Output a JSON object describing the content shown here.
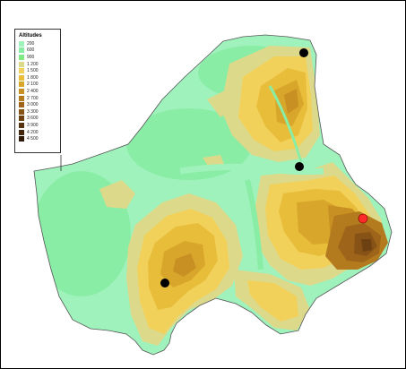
{
  "legend": {
    "title": "Altitudes",
    "items": [
      {
        "label": "200",
        "color": "#9ff2bc"
      },
      {
        "label": "600",
        "color": "#8aeda6"
      },
      {
        "label": "900",
        "color": "#7fe986"
      },
      {
        "label": "1 200",
        "color": "#dcd98a"
      },
      {
        "label": "1 500",
        "color": "#f2d15a"
      },
      {
        "label": "1 800",
        "color": "#e8bd3a"
      },
      {
        "label": "2 100",
        "color": "#d9a62c"
      },
      {
        "label": "2 400",
        "color": "#c88f22"
      },
      {
        "label": "2 700",
        "color": "#b47a1e"
      },
      {
        "label": "3 000",
        "color": "#9e651a"
      },
      {
        "label": "3 300",
        "color": "#875216"
      },
      {
        "label": "3 600",
        "color": "#6e4112"
      },
      {
        "label": "3 900",
        "color": "#58320f"
      },
      {
        "label": "4 200",
        "color": "#43260c"
      },
      {
        "label": "4 500",
        "color": "#2e1a08"
      }
    ]
  },
  "markers": [
    {
      "name": "marker-northeast",
      "color": "#000000"
    },
    {
      "name": "marker-central-east",
      "color": "#000000"
    },
    {
      "name": "marker-south",
      "color": "#000000"
    },
    {
      "name": "marker-east-highlighted",
      "color": "#ff2a2a"
    }
  ]
}
